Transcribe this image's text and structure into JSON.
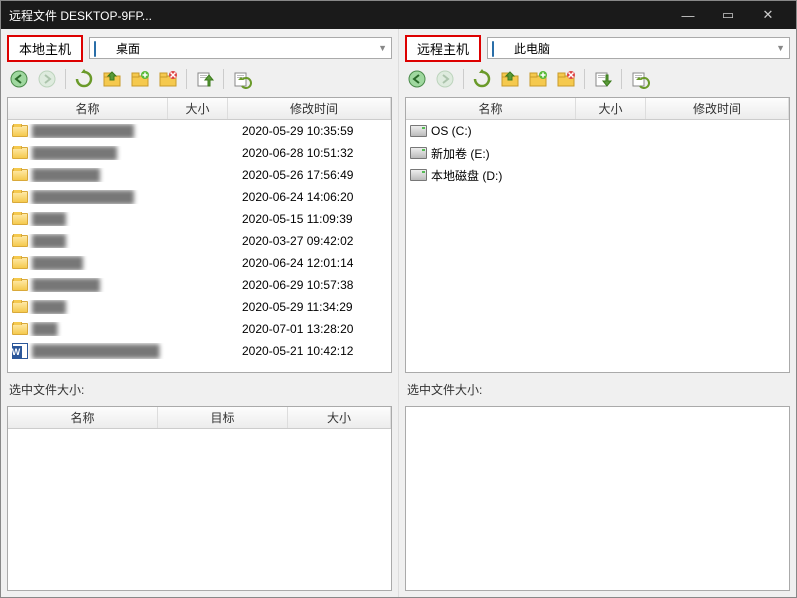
{
  "title": "远程文件 DESKTOP-9FP...",
  "winbtn": {
    "min": "—",
    "max": "▭",
    "close": "✕"
  },
  "left": {
    "host_label": "本地主机",
    "path_text": "桌面",
    "cols": {
      "name": "名称",
      "size": "大小",
      "date": "修改时间"
    },
    "rows": [
      {
        "icon": "folder",
        "name": "████████████",
        "date": "2020-05-29 10:35:59"
      },
      {
        "icon": "folder",
        "name": "██████████",
        "date": "2020-06-28 10:51:32"
      },
      {
        "icon": "folder",
        "name": "████████",
        "date": "2020-05-26 17:56:49"
      },
      {
        "icon": "folder",
        "name": "████████████",
        "date": "2020-06-24 14:06:20"
      },
      {
        "icon": "folder",
        "name": "████",
        "date": "2020-05-15 11:09:39"
      },
      {
        "icon": "folder",
        "name": "████",
        "date": "2020-03-27 09:42:02"
      },
      {
        "icon": "folder",
        "name": "██████",
        "date": "2020-06-24 12:01:14"
      },
      {
        "icon": "folder",
        "name": "████████",
        "date": "2020-06-29 10:57:38"
      },
      {
        "icon": "folder",
        "name": "████",
        "date": "2020-05-29 11:34:29"
      },
      {
        "icon": "folder",
        "name": "███",
        "date": "2020-07-01 13:28:20"
      },
      {
        "icon": "word",
        "name": "███████████████",
        "date": "2020-05-21 10:42:12"
      }
    ],
    "selected_label": "选中文件大小:",
    "tcols": {
      "name": "名称",
      "target": "目标",
      "size": "大小"
    }
  },
  "right": {
    "host_label": "远程主机",
    "path_text": "此电脑",
    "cols": {
      "name": "名称",
      "size": "大小",
      "date": "修改时间"
    },
    "rows": [
      {
        "icon": "drive",
        "name": "OS (C:)"
      },
      {
        "icon": "drive",
        "name": "新加卷 (E:)"
      },
      {
        "icon": "drive",
        "name": "本地磁盘 (D:)"
      }
    ],
    "selected_label": "选中文件大小:"
  },
  "colors": {
    "highlight_border": "#d00"
  }
}
